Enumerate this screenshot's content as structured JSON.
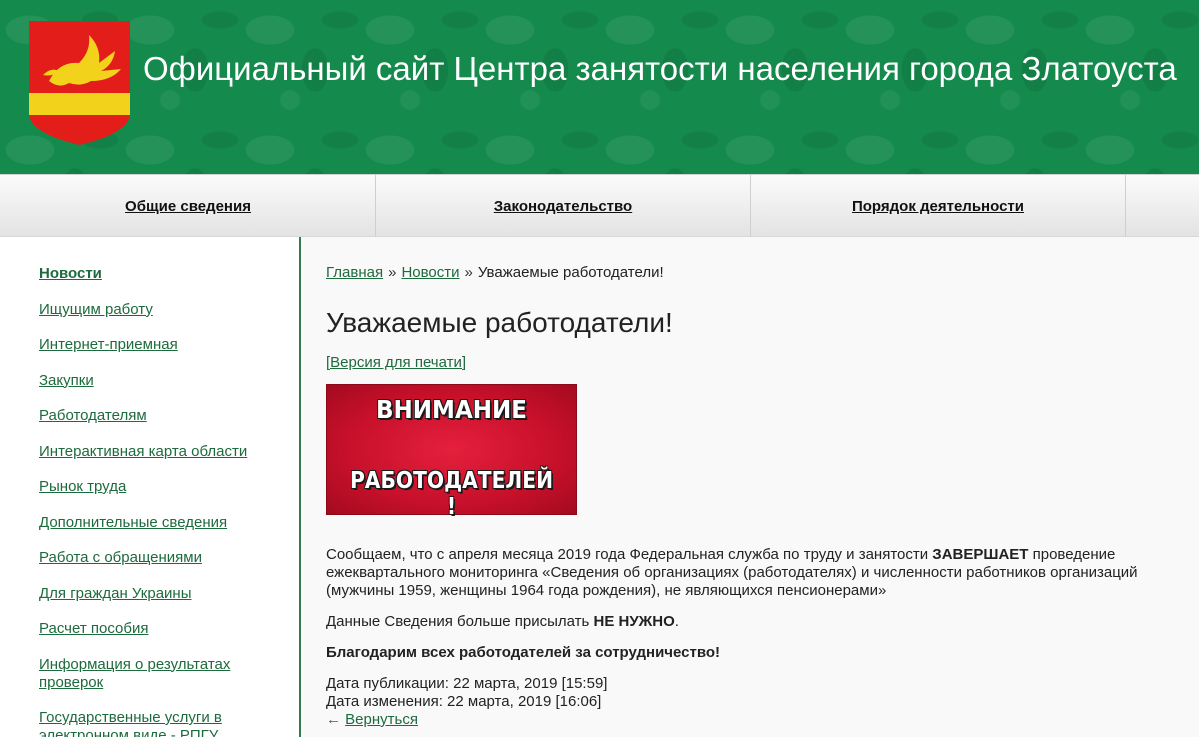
{
  "header": {
    "title": "Официальный сайт Центра занятости населения города Златоуста",
    "colors": {
      "background": "#148a4d",
      "title": "#ffffff"
    },
    "emblem_icon": "city-coat-of-arms-icon"
  },
  "nav": {
    "items": [
      {
        "label": "Общие сведения"
      },
      {
        "label": "Законодательство"
      },
      {
        "label": "Порядок деятельности"
      }
    ]
  },
  "sidebar": {
    "items": [
      {
        "label": "Новости",
        "active": true
      },
      {
        "label": "Ищущим работу"
      },
      {
        "label": "Интернет-приемная"
      },
      {
        "label": "Закупки"
      },
      {
        "label": "Работодателям"
      },
      {
        "label": "Интерактивная карта области"
      },
      {
        "label": "Рынок труда"
      },
      {
        "label": "Дополнительные сведения"
      },
      {
        "label": "Работа с обращениями"
      },
      {
        "label": "Для граждан Украины"
      },
      {
        "label": "Расчет пособия"
      },
      {
        "label": "Информация о результатах проверок"
      },
      {
        "label": "Государственные услуги в электронном виде - РПГУ"
      }
    ],
    "colors": {
      "link": "#1d6b3d",
      "divider": "#2e7d4a"
    }
  },
  "breadcrumb": {
    "home": "Главная",
    "sep": "»",
    "news": "Новости",
    "current": "Уважаемые работодатели!"
  },
  "article": {
    "title": "Уважаемые работодатели!",
    "print_link": "[Версия для печати]",
    "banner": {
      "line1": "ВНИМАНИЕ",
      "line2": "РАБОТОДАТЕЛЕЙ !",
      "color": "#d4142f"
    },
    "para1_start": "Сообщаем, что с апреля месяца 2019 года Федеральная служба по труду и занятости ",
    "para1_bold": "ЗАВЕРШАЕТ",
    "para1_end": " проведение ежеквартального мониторинга «Сведения об организациях (работодателях) и численности работников организаций (мужчины 1959, женщины 1964 года рождения), не являющихся пенсионерами»",
    "para2_start": "Данные Сведения больше присылать ",
    "para2_bold": "НЕ НУЖНО",
    "para2_end": ".",
    "para3": "Благодарим всех работодателей за сотрудничество!",
    "published": "Дата публикации: 22 марта, 2019 [15:59]",
    "modified": "Дата изменения: 22 марта, 2019 [16:06]",
    "back_arrow": "←",
    "back_label": "Вернуться"
  }
}
